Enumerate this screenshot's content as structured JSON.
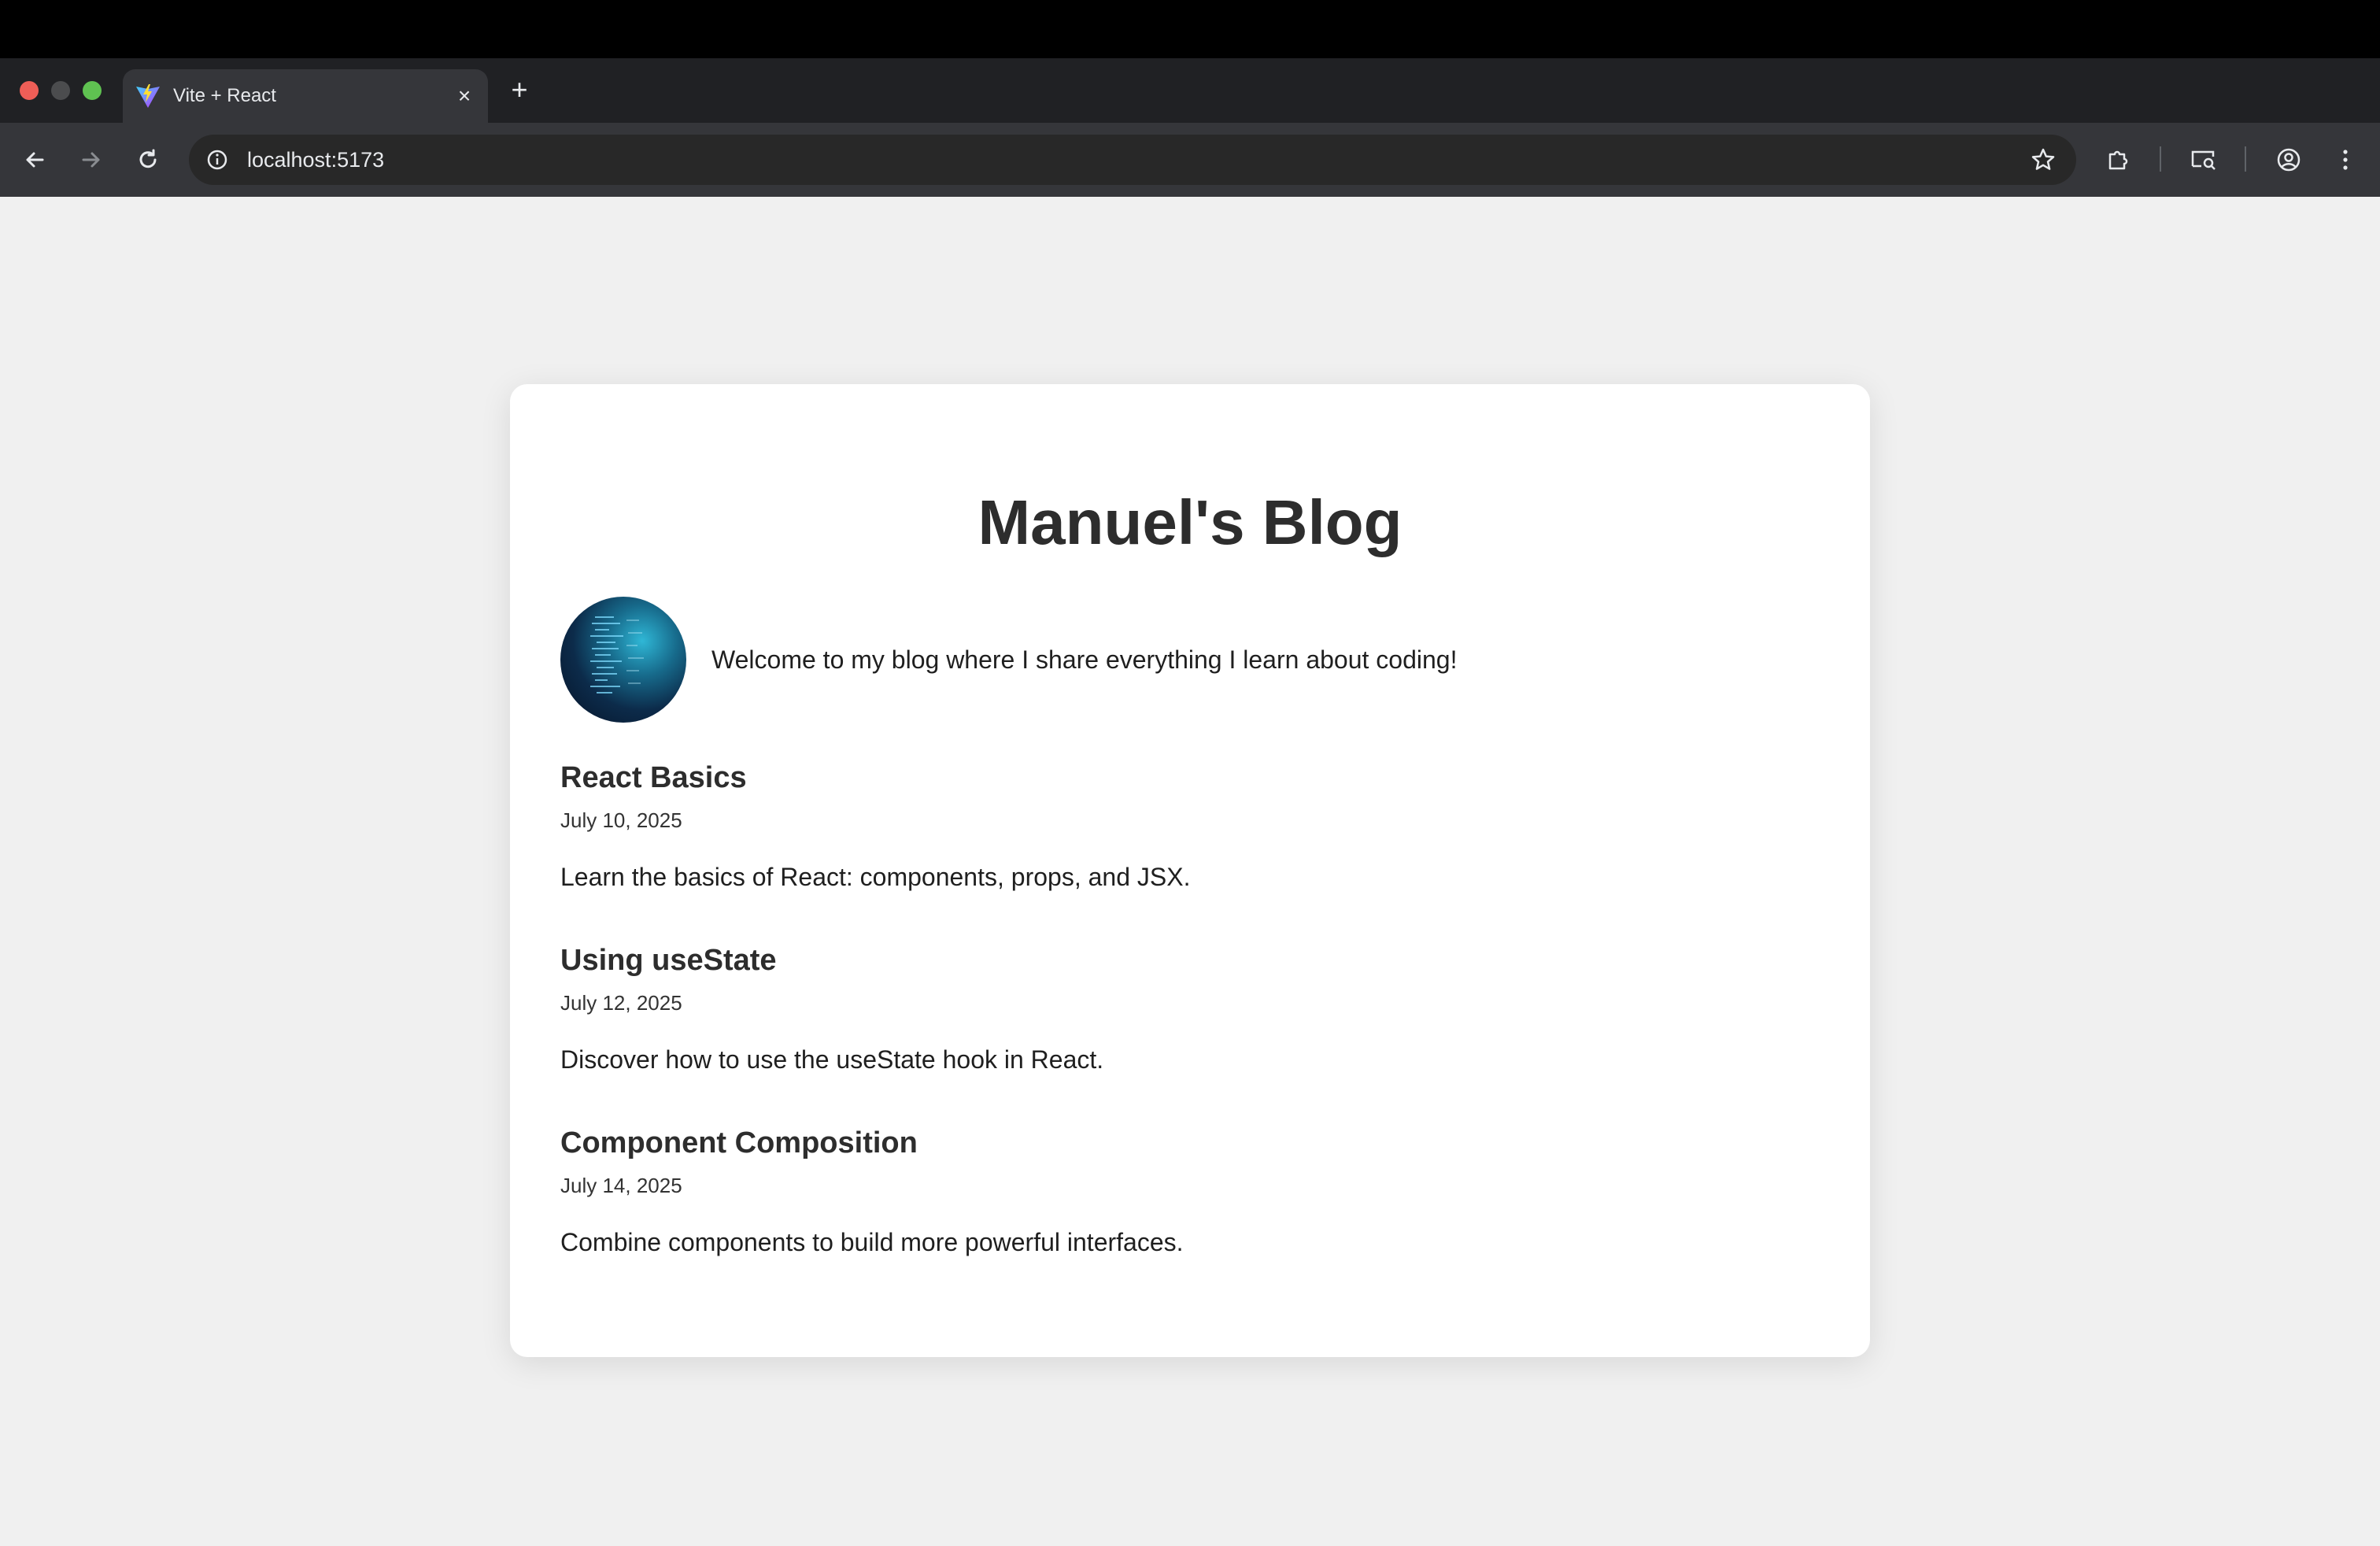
{
  "browser": {
    "tab": {
      "title": "Vite + React",
      "favicon": "vite-logo-icon",
      "close_icon": "×"
    },
    "new_tab_icon": "+",
    "address_bar": {
      "url": "localhost:5173"
    },
    "toolbar_icons": [
      "back-arrow-icon",
      "forward-arrow-icon",
      "reload-icon",
      "site-info-icon",
      "bookmark-star-icon",
      "extensions-icon",
      "cast-search-icon",
      "profile-icon",
      "menu-dots-icon"
    ]
  },
  "blog": {
    "title": "Manuel's Blog",
    "intro": "Welcome to my blog where I share everything I learn about coding!",
    "posts": [
      {
        "title": "React Basics",
        "date": "July 10, 2025",
        "body": "Learn the basics of React: components, props, and JSX."
      },
      {
        "title": "Using useState",
        "date": "July 12, 2025",
        "body": "Discover how to use the useState hook in React."
      },
      {
        "title": "Component Composition",
        "date": "July 14, 2025",
        "body": "Combine components to build more powerful interfaces."
      }
    ]
  },
  "colors": {
    "page_background": "#f0f0f0",
    "card_background": "#ffffff",
    "browser_toolbar": "#35363a",
    "tab_strip": "#202124"
  }
}
